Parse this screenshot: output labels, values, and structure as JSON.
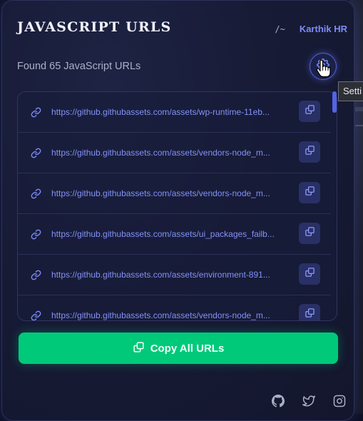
{
  "header": {
    "title": "JAVASCRIPT URLS",
    "slash": "/~",
    "author": "Karthik HR"
  },
  "summary": {
    "count_text": "Found 65 JavaScript URLs"
  },
  "settings": {
    "tooltip": "Setti"
  },
  "urls": [
    "https://github.githubassets.com/assets/wp-runtime-11eb...",
    "https://github.githubassets.com/assets/vendors-node_m...",
    "https://github.githubassets.com/assets/vendors-node_m...",
    "https://github.githubassets.com/assets/ui_packages_failb...",
    "https://github.githubassets.com/assets/environment-891...",
    "https://github.githubassets.com/assets/vendors-node_m..."
  ],
  "actions": {
    "copy_all_label": "Copy All URLs"
  },
  "footer": {
    "icons": [
      "github-icon",
      "twitter-icon",
      "instagram-icon"
    ]
  },
  "colors": {
    "accent": "#7c8cf8",
    "primary_green": "#00c97a",
    "panel_bg": "#171b36"
  }
}
